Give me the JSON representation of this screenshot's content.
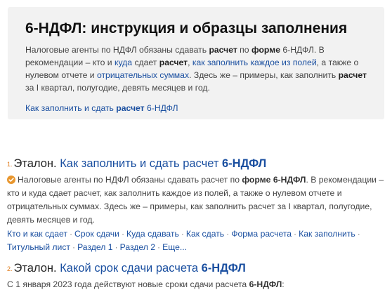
{
  "card": {
    "title": "6-НДФЛ: инструкция и образцы заполнения",
    "desc_1": "Налоговые агенты по НДФЛ обязаны сдавать ",
    "desc_b1": "расчет",
    "desc_2": " по ",
    "desc_b2": "форме",
    "desc_3": " 6-НДФЛ. В рекомендации – кто и ",
    "desc_link1": "куда",
    "desc_4": " сдает ",
    "desc_b3": "расчет",
    "desc_5": ", ",
    "desc_link2": "как заполнить каждое из полей",
    "desc_6": ", а также о нулевом отчете и ",
    "desc_link3": "отрицательных суммах",
    "desc_7": ". Здесь же – примеры, как заполнить ",
    "desc_b4": "расчет",
    "desc_8": " за I квартал, полугодие, девять месяцев и год.",
    "link_a": "Как заполнить и сдать ",
    "link_b": "расчет",
    "link_c": " 6-НДФЛ"
  },
  "results": [
    {
      "number": "1.",
      "site": "Эталон.",
      "title_a": " Как заполнить и сдать расчет ",
      "title_b": "6-НДФЛ",
      "desc_1": "Налоговые агенты по НДФЛ обязаны сдавать расчет по ",
      "desc_b1": "форме 6-НДФЛ",
      "desc_2": ". В рекомендации – кто и куда сдает расчет, как заполнить каждое из полей, а также о нулевом отчете и отрицательных суммах. Здесь же – примеры, как заполнить расчет за I квартал, полугодие, девять месяцев и год.",
      "sitelinks": [
        "Кто и как сдает",
        "Срок сдачи",
        "Куда сдавать",
        "Как сдать",
        "Форма расчета",
        "Как заполнить",
        "Титульный лист",
        "Раздел 1",
        "Раздел 2",
        "Еще..."
      ]
    },
    {
      "number": "2.",
      "site": "Эталон.",
      "title_a": " Какой срок сдачи расчета ",
      "title_b": "6-НДФЛ",
      "desc_1": "С 1 января 2023 года действуют новые сроки сдачи расчета ",
      "desc_b1": "6-НДФЛ",
      "desc_2": ":"
    }
  ],
  "colors": {
    "link": "#1a4fa0",
    "badge": "#e8962e",
    "card_bg": "#f2f2f2"
  },
  "icons": {
    "verified": "verified-check-icon"
  }
}
